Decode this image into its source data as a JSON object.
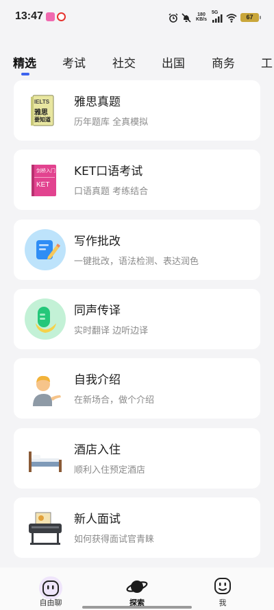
{
  "status_bar": {
    "time": "13:47",
    "net_speed_value": "180",
    "net_speed_unit": "KB/s",
    "signal_label": "5G",
    "battery": "67"
  },
  "tabs": [
    {
      "label": "精选",
      "active": true
    },
    {
      "label": "考试",
      "active": false
    },
    {
      "label": "社交",
      "active": false
    },
    {
      "label": "出国",
      "active": false
    },
    {
      "label": "商务",
      "active": false
    },
    {
      "label": "工",
      "active": false
    }
  ],
  "cards": [
    {
      "title": "雅思真题",
      "subtitle": "历年题库 全真模拟",
      "icon": "ielts-book-icon",
      "icon_text": [
        "IELTS",
        "雅思",
        "要知道"
      ]
    },
    {
      "title": "KET口语考试",
      "subtitle": "口语真题 考练结合",
      "icon": "ket-book-icon",
      "icon_text": [
        "剑桥入门",
        "KET"
      ]
    },
    {
      "title": "写作批改",
      "subtitle": "一键批改，语法检测、表达润色",
      "icon": "writing-correction-icon"
    },
    {
      "title": "同声传译",
      "subtitle": "实时翻译 边听边译",
      "icon": "simultaneous-interpretation-icon"
    },
    {
      "title": "自我介绍",
      "subtitle": "在新场合，做个介绍",
      "icon": "person-introducing-icon"
    },
    {
      "title": "酒店入住",
      "subtitle": "顺利入住预定酒店",
      "icon": "hotel-bed-icon"
    },
    {
      "title": "新人面试",
      "subtitle": "如何获得面试官青睐",
      "icon": "interview-printer-icon"
    }
  ],
  "bottom_nav": [
    {
      "label": "自由聊",
      "icon": "free-chat-icon",
      "active": false
    },
    {
      "label": "探索",
      "icon": "planet-explore-icon",
      "active": true
    },
    {
      "label": "我",
      "icon": "profile-face-icon",
      "active": false
    }
  ],
  "colors": {
    "accent": "#3d63ee",
    "background": "#f4f4f6",
    "card": "#ffffff",
    "subtitle": "#8a8a8a"
  }
}
